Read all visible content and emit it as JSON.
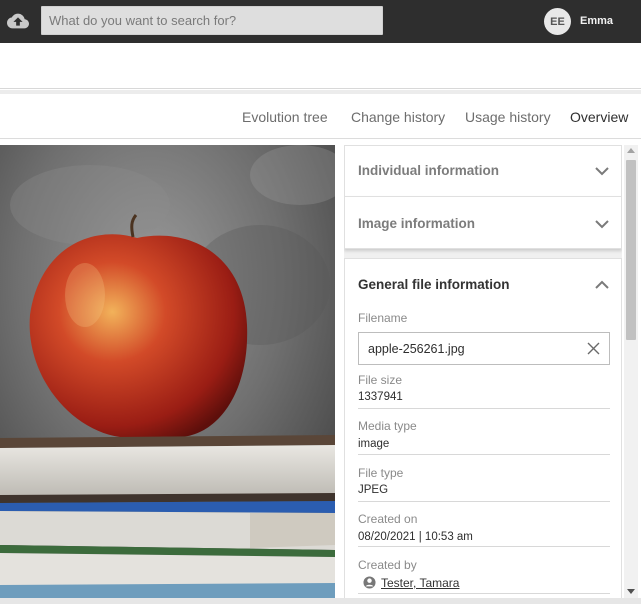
{
  "header": {
    "search_placeholder": "What do you want to search for?",
    "user_initials": "EE",
    "user_name": "Emma"
  },
  "tabs": [
    {
      "label": "Evolution tree",
      "active": false
    },
    {
      "label": "Change history",
      "active": false
    },
    {
      "label": "Usage history",
      "active": false
    },
    {
      "label": "Overview",
      "active": true
    }
  ],
  "panel": {
    "sections": {
      "individual": {
        "title": "Individual information",
        "expanded": false
      },
      "image": {
        "title": "Image information",
        "expanded": false
      },
      "general": {
        "title": "General file information",
        "expanded": true
      }
    },
    "fields": {
      "filename_label": "Filename",
      "filename_value": "apple-256261.jpg",
      "filesize_label": "File size",
      "filesize_value": "1337941",
      "mediatype_label": "Media type",
      "mediatype_value": "image",
      "filetype_label": "File type",
      "filetype_value": "JPEG",
      "created_on_label": "Created on",
      "created_on_value": "08/20/2021 | 10:53 am",
      "created_by_label": "Created by",
      "created_by_value": "Tester, Tamara"
    }
  },
  "colors": {
    "topbar": "#2e2e2e",
    "accent_text": "#333333",
    "muted_text": "#7c7c7c"
  },
  "icons": [
    "cloud-upload-icon",
    "chevron-down-icon",
    "chevron-up-icon",
    "clear-icon",
    "person-icon"
  ]
}
